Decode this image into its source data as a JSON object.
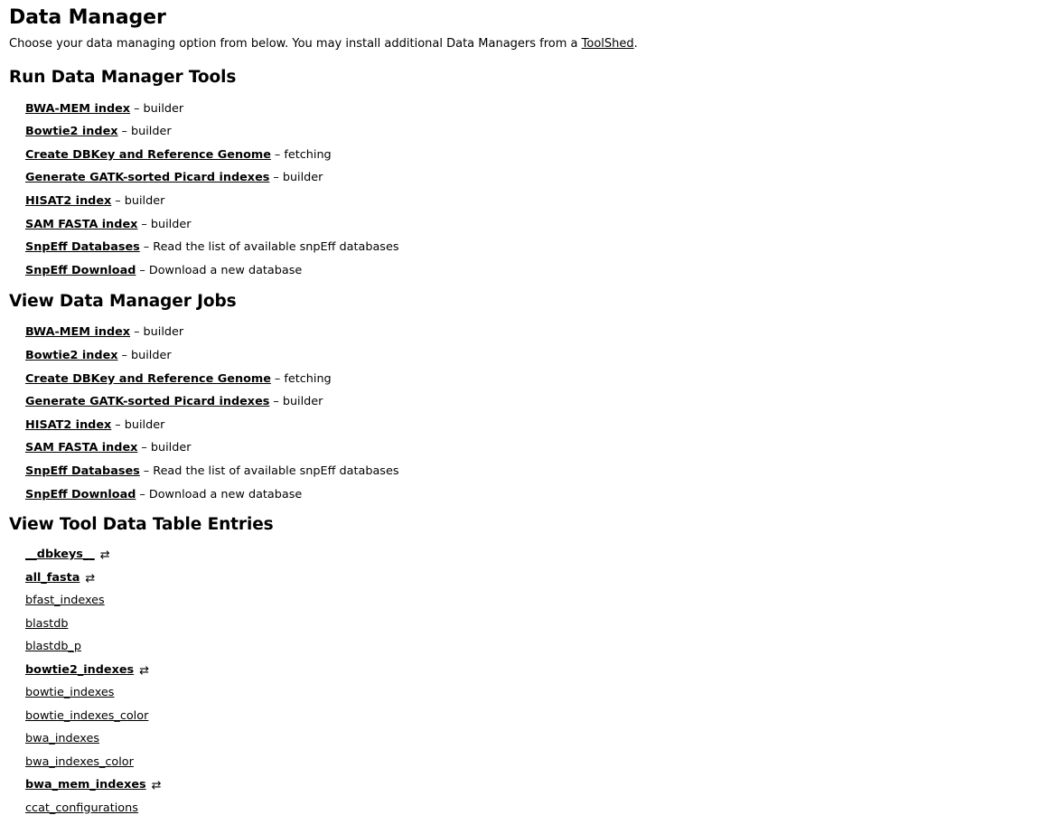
{
  "page": {
    "title": "Data Manager",
    "intro_before": "Choose your data managing option from below. You may install additional Data Managers from a ",
    "intro_link": "ToolShed",
    "intro_after": "."
  },
  "sections": {
    "run_tools": {
      "heading": "Run Data Manager Tools",
      "items": [
        {
          "name": "BWA-MEM index",
          "desc": "– builder"
        },
        {
          "name": "Bowtie2 index",
          "desc": "– builder"
        },
        {
          "name": "Create DBKey and Reference Genome",
          "desc": "– fetching"
        },
        {
          "name": "Generate GATK-sorted Picard indexes",
          "desc": "– builder"
        },
        {
          "name": "HISAT2 index",
          "desc": "– builder"
        },
        {
          "name": "SAM FASTA index",
          "desc": "– builder"
        },
        {
          "name": "SnpEff Databases",
          "desc": "– Read the list of available snpEff databases"
        },
        {
          "name": "SnpEff Download",
          "desc": "– Download a new database"
        }
      ]
    },
    "view_jobs": {
      "heading": "View Data Manager Jobs",
      "items": [
        {
          "name": "BWA-MEM index",
          "desc": "– builder"
        },
        {
          "name": "Bowtie2 index",
          "desc": "– builder"
        },
        {
          "name": "Create DBKey and Reference Genome",
          "desc": "– fetching"
        },
        {
          "name": "Generate GATK-sorted Picard indexes",
          "desc": "– builder"
        },
        {
          "name": "HISAT2 index",
          "desc": "– builder"
        },
        {
          "name": "SAM FASTA index",
          "desc": "– builder"
        },
        {
          "name": "SnpEff Databases",
          "desc": "– Read the list of available snpEff databases"
        },
        {
          "name": "SnpEff Download",
          "desc": "– Download a new database"
        }
      ]
    },
    "tool_data_tables": {
      "heading": "View Tool Data Table Entries",
      "swap_icon_glyph": "⇄",
      "items": [
        {
          "name": "__dbkeys__",
          "bold": true,
          "icon": true
        },
        {
          "name": "all_fasta",
          "bold": true,
          "icon": true
        },
        {
          "name": "bfast_indexes",
          "bold": false,
          "icon": false
        },
        {
          "name": "blastdb",
          "bold": false,
          "icon": false
        },
        {
          "name": "blastdb_p",
          "bold": false,
          "icon": false
        },
        {
          "name": "bowtie2_indexes",
          "bold": true,
          "icon": true
        },
        {
          "name": "bowtie_indexes",
          "bold": false,
          "icon": false
        },
        {
          "name": "bowtie_indexes_color",
          "bold": false,
          "icon": false
        },
        {
          "name": "bwa_indexes",
          "bold": false,
          "icon": false
        },
        {
          "name": "bwa_indexes_color",
          "bold": false,
          "icon": false
        },
        {
          "name": "bwa_mem_indexes",
          "bold": true,
          "icon": true
        },
        {
          "name": "ccat_configurations",
          "bold": false,
          "icon": false
        }
      ]
    }
  }
}
